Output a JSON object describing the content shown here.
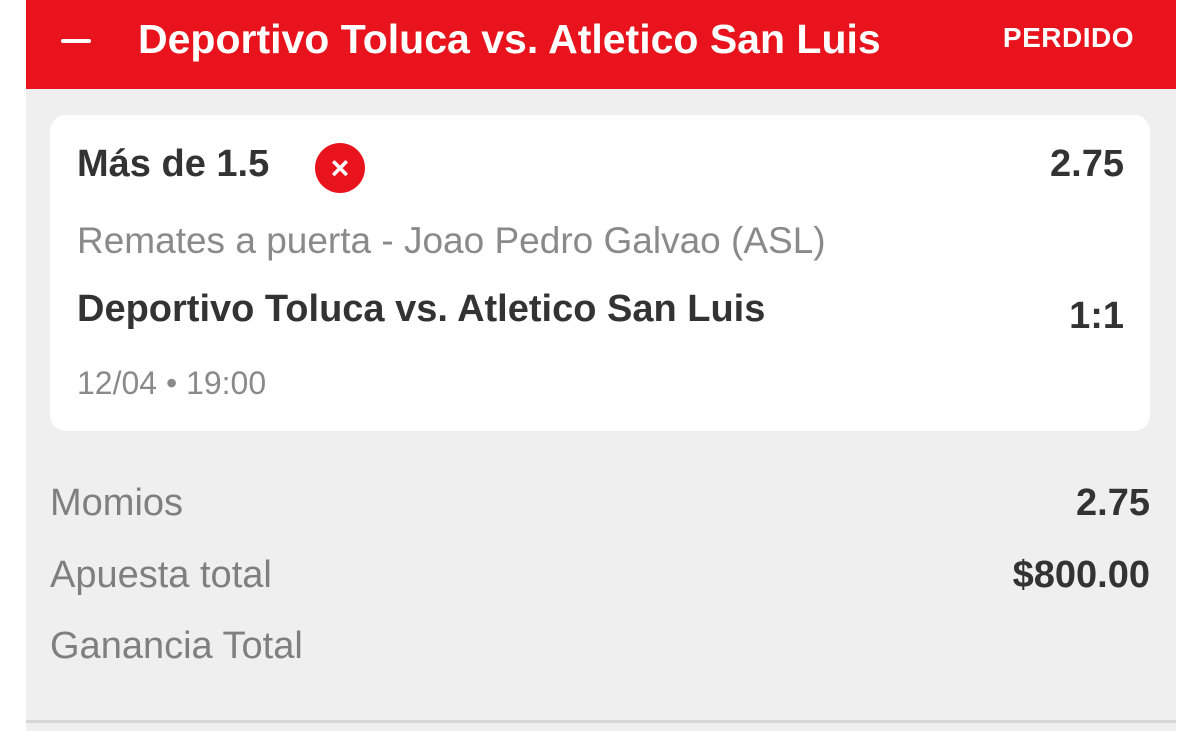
{
  "header": {
    "collapse_icon": "minus-icon",
    "title": "Deportivo Toluca vs. Atletico San Luis",
    "status": "PERDIDO",
    "color": "#e8131c"
  },
  "bet": {
    "selection": "Más de 1.5",
    "result_icon": "close-circle-icon",
    "odds": "2.75",
    "market": "Remates a puerta - Joao Pedro Galvao (ASL)",
    "event": "Deportivo Toluca vs. Atletico San Luis",
    "score": "1:1",
    "datetime": "12/04 • 19:00"
  },
  "summary": {
    "momios_label": "Momios",
    "momios_value": "2.75",
    "stake_label": "Apuesta total",
    "stake_value": "$800.00",
    "winnings_label": "Ganancia Total",
    "winnings_value": ""
  }
}
